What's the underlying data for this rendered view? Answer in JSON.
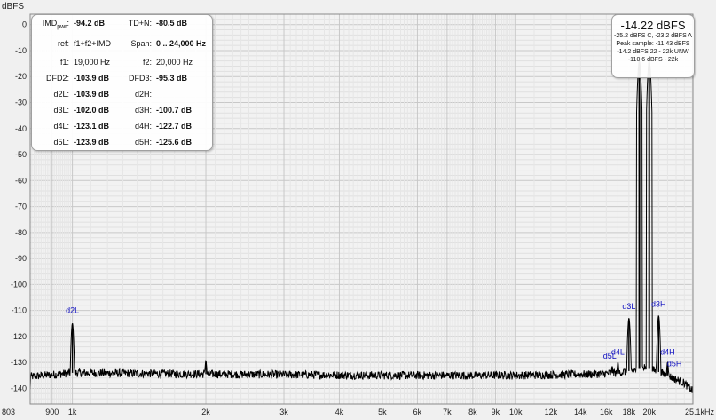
{
  "chart_data": {
    "type": "line",
    "ylabel": "dBFS",
    "ylim": [
      -146,
      4
    ],
    "xlim": [
      803,
      25100
    ],
    "x_scale": "log",
    "y_ticks": [
      0,
      -10,
      -20,
      -30,
      -40,
      -50,
      -60,
      -70,
      -80,
      -90,
      -100,
      -110,
      -120,
      -130,
      -140
    ],
    "x_tick_values": [
      803,
      900,
      1000,
      2000,
      3000,
      4000,
      5000,
      6000,
      7000,
      8000,
      9000,
      10000,
      12000,
      14000,
      16000,
      18000,
      20000,
      25100
    ],
    "x_tick_labels": [
      "803",
      "900",
      "1k",
      "2k",
      "3k",
      "4k",
      "5k",
      "6k",
      "7k",
      "8k",
      "9k",
      "10k",
      "12k",
      "14k",
      "16k",
      "18k",
      "20k",
      "25.1kHz"
    ],
    "noise_floor_db": -134.5,
    "series": [
      {
        "points": [
          [
            803,
            -135.5
          ],
          [
            1000,
            -134
          ],
          [
            2000,
            -134.5
          ],
          [
            5000,
            -135
          ],
          [
            10000,
            -135
          ],
          [
            15000,
            -134.5
          ],
          [
            17000,
            -134
          ],
          [
            18500,
            -133
          ],
          [
            19500,
            -132
          ],
          [
            20500,
            -133
          ],
          [
            22000,
            -135
          ],
          [
            24000,
            -138
          ],
          [
            25100,
            -141
          ]
        ]
      }
    ],
    "peaks": [
      {
        "x": 1000,
        "y": -115
      },
      {
        "x": 2000,
        "y": -129.5
      },
      {
        "x": 16500,
        "y": -131.5
      },
      {
        "x": 17000,
        "y": -130
      },
      {
        "x": 18000,
        "y": -113
      },
      {
        "x": 19000,
        "y": -14.2
      },
      {
        "x": 20000,
        "y": -14.2
      },
      {
        "x": 21000,
        "y": -112
      },
      {
        "x": 22000,
        "y": -130
      }
    ],
    "annotations": [
      {
        "text": "d2L",
        "x": 1000,
        "y": -111
      },
      {
        "text": "d3L",
        "x": 18000,
        "y": -109.5
      },
      {
        "text": "d3H",
        "x": 21000,
        "y": -108.5
      },
      {
        "text": "d4L",
        "x": 17000,
        "y": -127
      },
      {
        "text": "d5L",
        "x": 16300,
        "y": -128.5
      },
      {
        "text": "d4H",
        "x": 22000,
        "y": -127
      },
      {
        "text": "d5H",
        "x": 22800,
        "y": -131.5
      }
    ],
    "grid": true
  },
  "stats": {
    "imd_label_a": "IMD",
    "imd_label_b": "pwr",
    "imd_label_c": ":",
    "imd_value": "-94.2 dB",
    "tdn_label": "TD+N:",
    "tdn_value": "-80.5 dB",
    "ref_label": "ref:",
    "ref_value": "f1+f2+IMD",
    "span_label": "Span:",
    "span_value": "0 .. 24,000 Hz",
    "f1_label": "f1:",
    "f1_value": "19,000 Hz",
    "f2_label": "f2:",
    "f2_value": "20,000 Hz",
    "dfd2_label": "DFD2:",
    "dfd2_value": "-103.9 dB",
    "dfd3_label": "DFD3:",
    "dfd3_value": "-95.3 dB",
    "d2l_label": "d2L:",
    "d2l_value": "-103.9 dB",
    "d2h_label": "d2H:",
    "d2h_value": "",
    "d3l_label": "d3L:",
    "d3l_value": "-102.0 dB",
    "d3h_label": "d3H:",
    "d3h_value": "-100.7 dB",
    "d4l_label": "d4L:",
    "d4l_value": "-123.1 dB",
    "d4h_label": "d4H:",
    "d4h_value": "-122.7 dB",
    "d5l_label": "d5L:",
    "d5l_value": "-123.9 dB",
    "d5h_label": "d5H:",
    "d5h_value": "-125.6 dB"
  },
  "level": {
    "main": "-14.22 dBFS",
    "line1": "-25.2 dBFS C, -23.2 dBFS A",
    "line2": "Peak sample: -11.43 dBFS",
    "line3": "-14.2 dBFS 22 - 22k UNW",
    "line4": "-110.6 dBFS - 22k"
  },
  "colors": {
    "background": "#f0f0f0",
    "grid": "#d4d4d4",
    "trace": "#000000",
    "annotation": "#1010c0"
  }
}
